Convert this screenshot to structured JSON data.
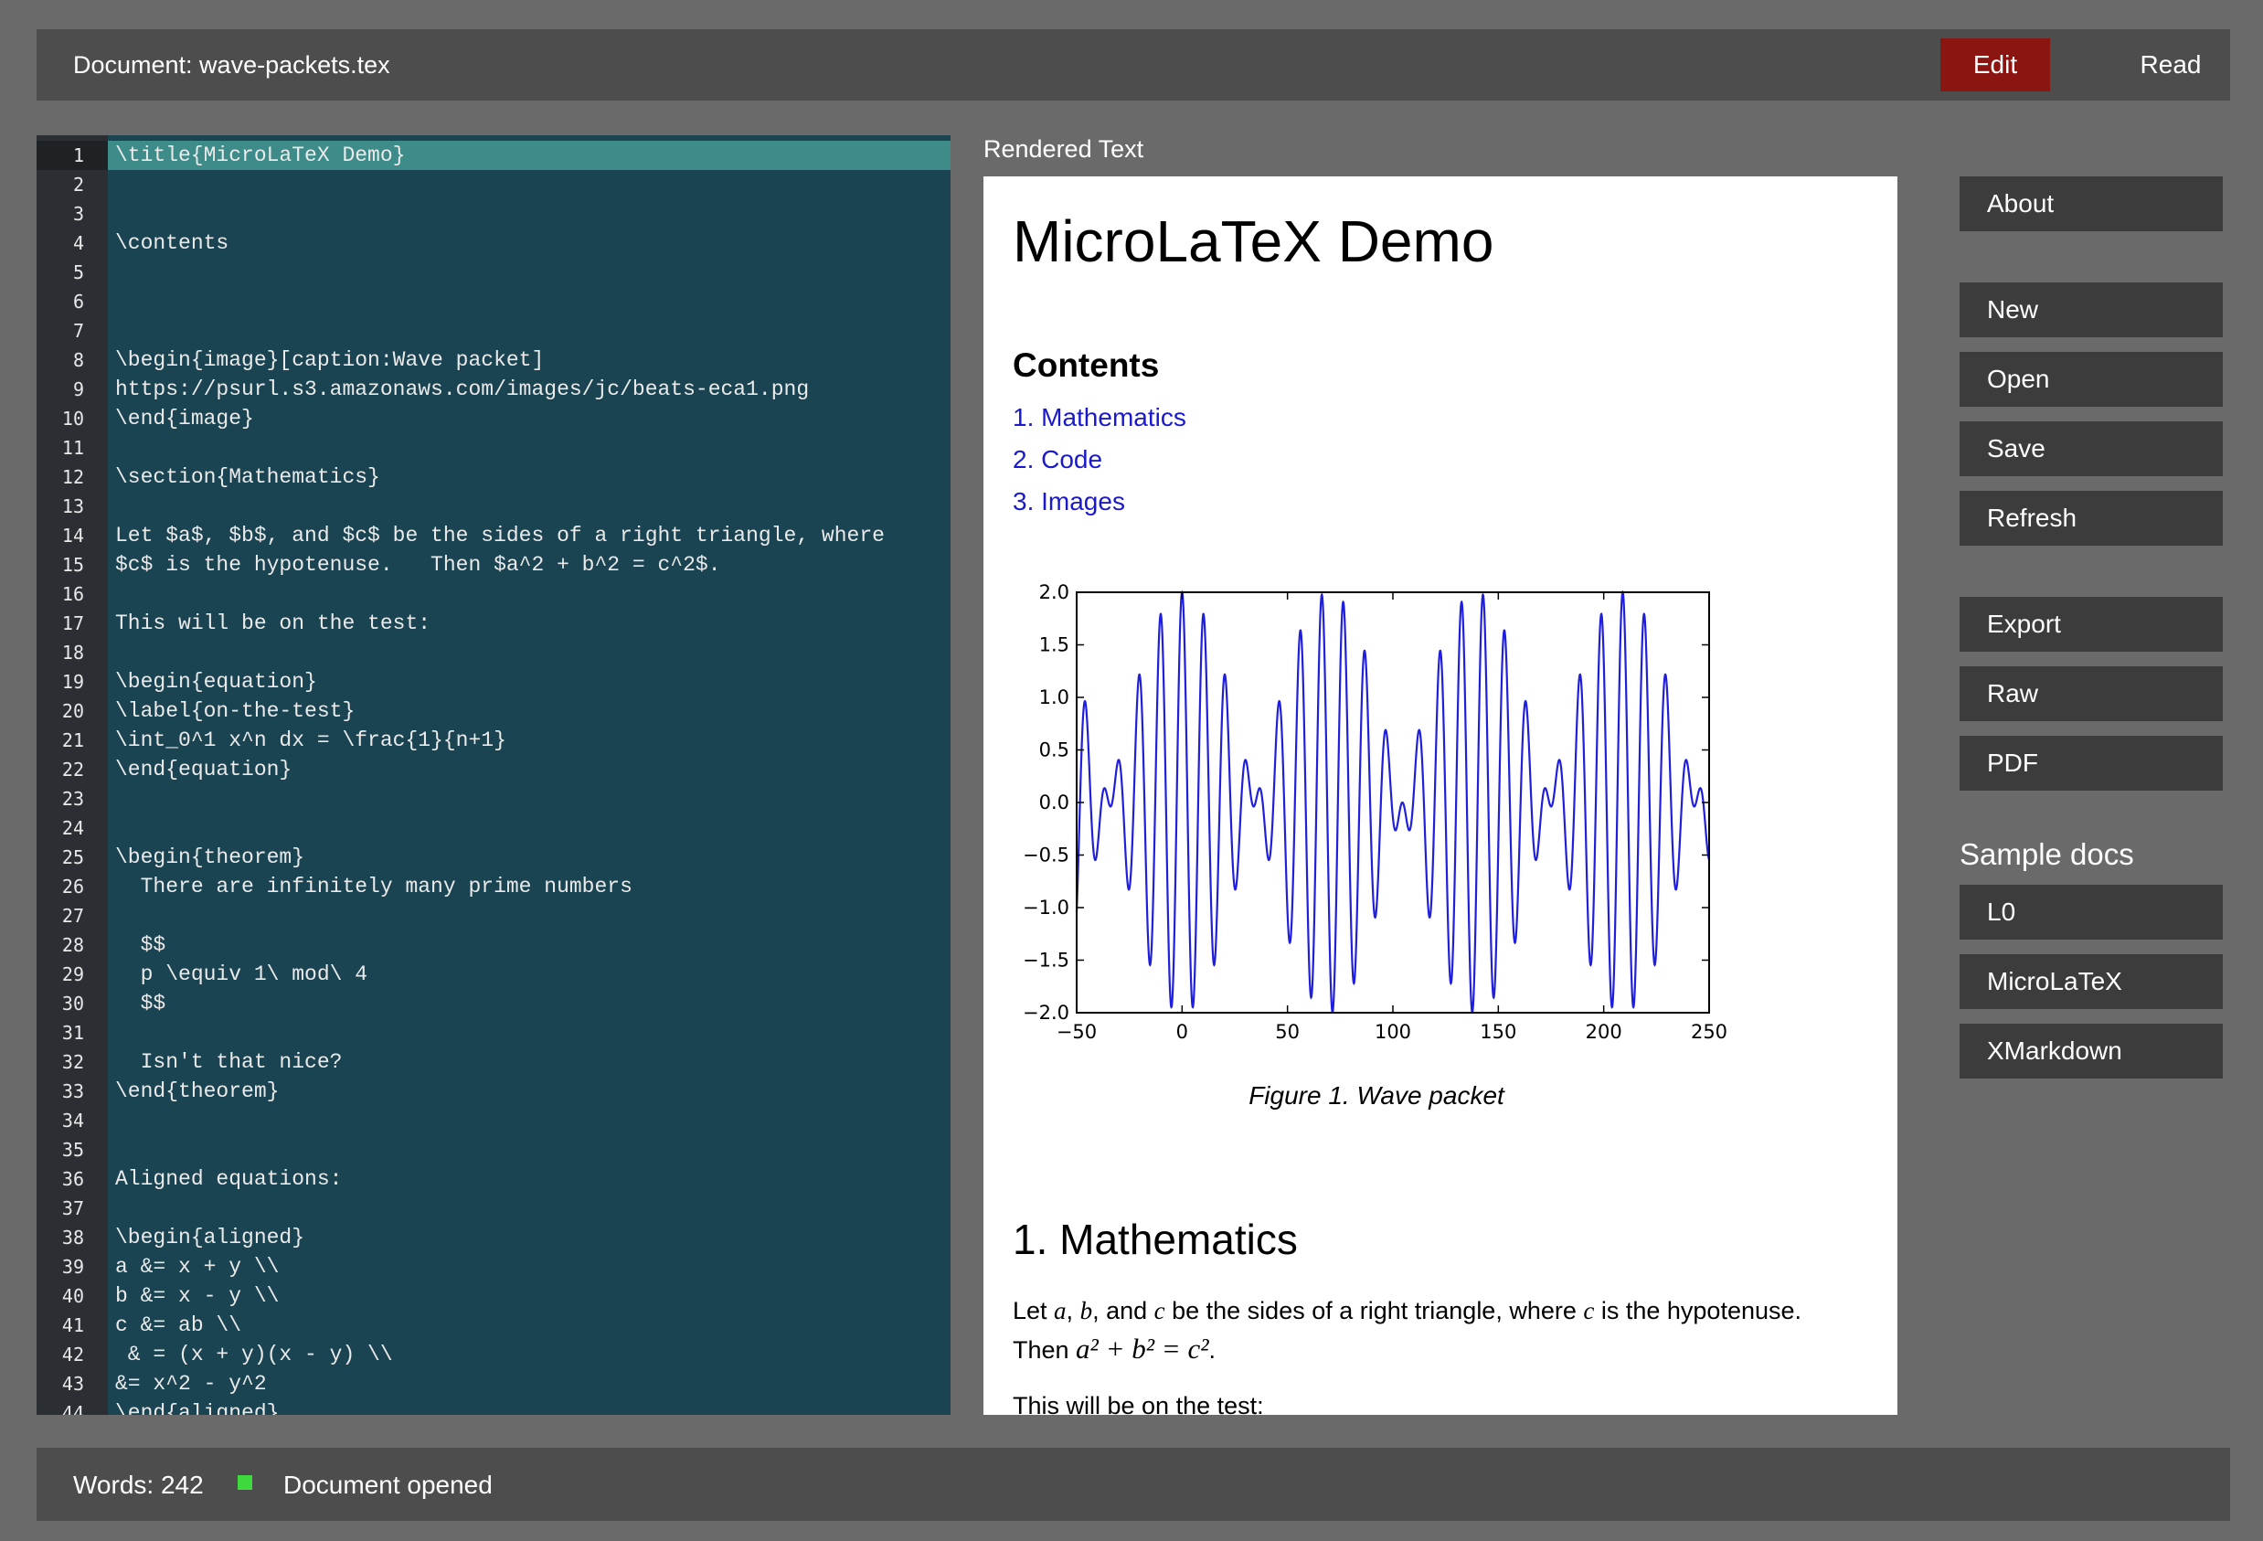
{
  "header": {
    "doc_title": "Document: wave-packets.tex",
    "edit_label": "Edit",
    "read_label": "Read"
  },
  "editor": {
    "lines": [
      "\\title{MicroLaTeX Demo}",
      "",
      "",
      "\\contents",
      "",
      "",
      "",
      "\\begin{image}[caption:Wave packet]",
      "https://psurl.s3.amazonaws.com/images/jc/beats-eca1.png",
      "\\end{image}",
      "",
      "\\section{Mathematics}",
      "",
      "Let $a$, $b$, and $c$ be the sides of a right triangle, where",
      "$c$ is the hypotenuse.   Then $a^2 + b^2 = c^2$.",
      "",
      "This will be on the test:",
      "",
      "\\begin{equation}",
      "\\label{on-the-test}",
      "\\int_0^1 x^n dx = \\frac{1}{n+1}",
      "\\end{equation}",
      "",
      "",
      "\\begin{theorem}",
      "  There are infinitely many prime numbers",
      "",
      "  $$",
      "  p \\equiv 1\\ mod\\ 4",
      "  $$",
      "",
      "  Isn't that nice?",
      "\\end{theorem}",
      "",
      "",
      "Aligned equations:",
      "",
      "\\begin{aligned}",
      "a &= x + y \\\\",
      "b &= x - y \\\\",
      "c &= ab \\\\",
      " & = (x + y)(x - y) \\\\",
      "&= x^2 - y^2",
      "\\end{aligned}"
    ]
  },
  "rendered": {
    "label": "Rendered Text",
    "title": "MicroLaTeX Demo",
    "contents_heading": "Contents",
    "toc": [
      "1. Mathematics",
      "2. Code",
      "3. Images"
    ],
    "figure_caption": "Figure 1. Wave packet",
    "section_heading": "1. Mathematics",
    "para_prefix": "Let ",
    "para_a": "a",
    "para_sep1": ", ",
    "para_b": "b",
    "para_sep2": ", and ",
    "para_c": "c",
    "para_mid": " be the sides of a right triangle, where ",
    "para_c2": "c",
    "para_suffix": " is the hypotenuse.",
    "para_then": "Then ",
    "para_eq": "a² + b² = c²",
    "para_end": ".",
    "para2": "This will be on the test:"
  },
  "chart_data": {
    "type": "line",
    "title": "",
    "xlabel": "",
    "ylabel": "",
    "xlim": [
      -50,
      250
    ],
    "ylim": [
      -2.0,
      2.0
    ],
    "xticks": [
      "−50",
      "0",
      "50",
      "100",
      "150",
      "200",
      "250"
    ],
    "yticks": [
      "2.0",
      "1.5",
      "1.0",
      "0.5",
      "0.0",
      "−0.5",
      "−1.0",
      "−1.5",
      "−2.0"
    ],
    "series": [
      {
        "description": "sum of two close-frequency sinusoids (beats)",
        "color": "#1f1fdd"
      }
    ]
  },
  "sidebar": {
    "about": "About",
    "new": "New",
    "open": "Open",
    "save": "Save",
    "refresh": "Refresh",
    "export": "Export",
    "raw": "Raw",
    "pdf": "PDF",
    "sample_label": "Sample docs",
    "samples": [
      "L0",
      "MicroLaTeX",
      "XMarkdown"
    ]
  },
  "status": {
    "words": "Words: 242",
    "message": "Document opened",
    "indicator_color": "#3dd93d"
  }
}
